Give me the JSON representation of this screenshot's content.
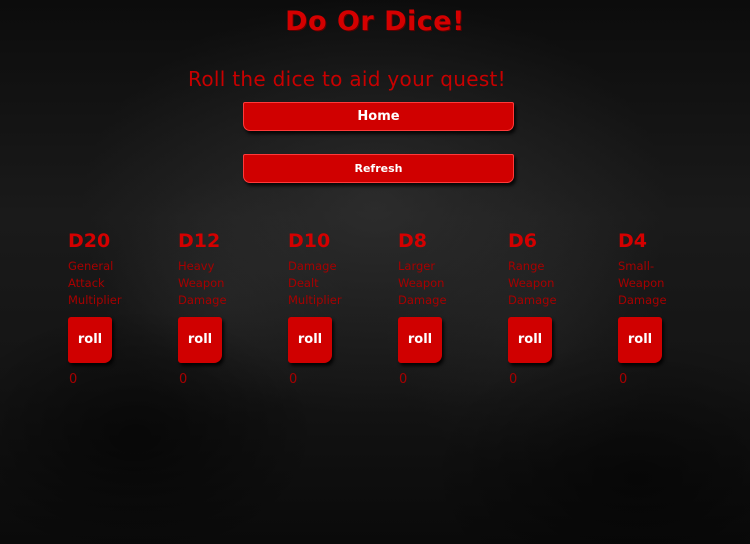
{
  "header": {
    "title": "Do Or Dice!",
    "subtitle": "Roll the dice to aid your quest!"
  },
  "nav": {
    "home_label": "Home",
    "refresh_label": "Refresh"
  },
  "dice": [
    {
      "name": "D20",
      "description": "General\nAttack\nMultiplier",
      "roll_label": "roll",
      "result": "0"
    },
    {
      "name": "D12",
      "description": "Heavy\nWeapon\nDamage",
      "roll_label": "roll",
      "result": "0"
    },
    {
      "name": "D10",
      "description": "Damage\nDealt\nMultiplier",
      "roll_label": "roll",
      "result": "0"
    },
    {
      "name": "D8",
      "description": "Larger\nWeapon\nDamage",
      "roll_label": "roll",
      "result": "0"
    },
    {
      "name": "D6",
      "description": "Range\nWeapon\nDamage",
      "roll_label": "roll",
      "result": "0"
    },
    {
      "name": "D4",
      "description": "Small-\nWeapon\nDamage",
      "roll_label": "roll",
      "result": "0"
    }
  ],
  "colors": {
    "accent_red": "#d00000",
    "text_red": "#a80000",
    "background": "#121212"
  }
}
